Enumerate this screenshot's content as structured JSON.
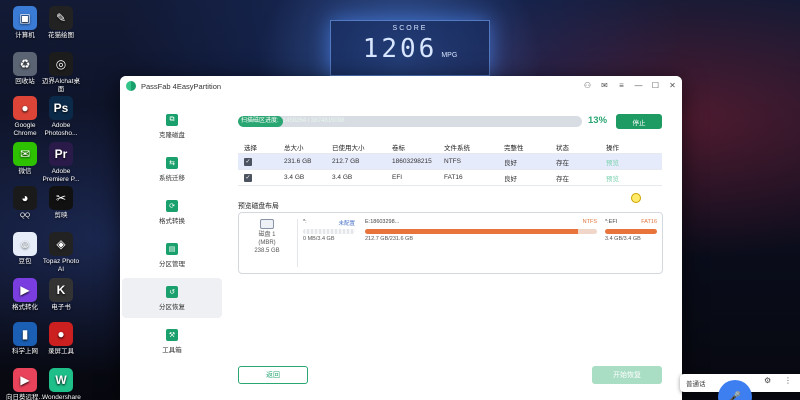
{
  "desktop": {
    "score_label": "SCORE",
    "score_value": "1206",
    "score_unit": "MPG",
    "icons": [
      {
        "label": "计算机",
        "glyph": "▣",
        "color": "#3a7bd5"
      },
      {
        "label": "花猫绘图",
        "glyph": "✎",
        "color": "#222222"
      },
      {
        "label": "回收站",
        "glyph": "♻",
        "color": "#5b6472"
      },
      {
        "label": "迈界AIchat桌面",
        "glyph": "◎",
        "color": "#1c1c1c"
      },
      {
        "label": "Google Chrome",
        "glyph": "●",
        "color": "#db4437"
      },
      {
        "label": "Adobe Photosho...",
        "glyph": "Ps",
        "color": "#0b2a4a"
      },
      {
        "label": "微信",
        "glyph": "✉",
        "color": "#2dc100"
      },
      {
        "label": "Adobe Premiere P...",
        "glyph": "Pr",
        "color": "#2a1a4a"
      },
      {
        "label": "",
        "glyph": "✂",
        "color": "#111111"
      },
      {
        "label": "剪映",
        "glyph": "✂",
        "color": "#111111"
      },
      {
        "label": "QQ",
        "glyph": "◕",
        "color": "#1a1a1a"
      },
      {
        "label": "",
        "glyph": "",
        "color": "transparent"
      },
      {
        "label": "豆包",
        "glyph": "☺",
        "color": "#e7eef9"
      },
      {
        "label": "Topaz Photo AI",
        "glyph": "◈",
        "color": "#222222"
      },
      {
        "label": "格式转化",
        "glyph": "▶",
        "color": "#7a3ee0"
      },
      {
        "label": "电子书",
        "glyph": "K",
        "color": "#333333"
      },
      {
        "label": "科学上网",
        "glyph": "▮",
        "color": "#1a5fb4"
      },
      {
        "label": "录屏工具",
        "glyph": "●",
        "color": "#cc1f1f"
      },
      {
        "label": "向日葵远程...",
        "glyph": "▶",
        "color": "#e8435a"
      },
      {
        "label": "Wondershare Filmora",
        "glyph": "W",
        "color": "#1fbf8a"
      }
    ]
  },
  "app": {
    "title": "PassFab 4EasyPartition",
    "sidebar": [
      {
        "label": "克隆磁盘",
        "active": false
      },
      {
        "label": "系统迁移",
        "active": false
      },
      {
        "label": "格式转换",
        "active": false
      },
      {
        "label": "分区管理",
        "active": false
      },
      {
        "label": "分区恢复",
        "active": true
      },
      {
        "label": "工具箱",
        "active": false
      }
    ],
    "scan": {
      "label": "扫描磁区进度:",
      "detail": "1458264 / 3874815098",
      "progress": 0.13,
      "percent_text": "13%",
      "stop_label": "停止"
    },
    "table": {
      "headers": [
        "选择",
        "总大小",
        "已使用大小",
        "卷标",
        "文件系统",
        "完整性",
        "状态",
        "操作"
      ],
      "rows": [
        {
          "selected": true,
          "checked": "✓",
          "total": "231.6 GB",
          "used": "212.7 GB",
          "label": "18603298215",
          "fs": "NTFS",
          "integrity": "良好",
          "status": "存在",
          "action": "预览"
        },
        {
          "selected": false,
          "checked": "✓",
          "total": "3.4 GB",
          "used": "3.4 GB",
          "label": "EFI",
          "fs": "FAT16",
          "integrity": "良好",
          "status": "存在",
          "action": "预览"
        }
      ]
    },
    "layout": {
      "title": "预览磁盘布局",
      "disk": {
        "name": "磁盘 1",
        "type": "(MBR)",
        "size": "238.5 GB"
      },
      "partitions": [
        {
          "name": "*:",
          "fs": "未配置",
          "size": "0 MB/3.4 GB",
          "used_fraction": 0.0
        },
        {
          "name": "E:18603298...",
          "fs": "NTFS",
          "size": "212.7 GB/231.6 GB",
          "used_fraction": 0.92
        },
        {
          "name": "*:EFI",
          "fs": "FAT16",
          "size": "3.4 GB/3.4 GB",
          "used_fraction": 1.0
        }
      ]
    },
    "back_label": "返回",
    "start_label": "开始恢复"
  },
  "input_method": {
    "label": "普通话",
    "mic_glyph": "🎤"
  }
}
